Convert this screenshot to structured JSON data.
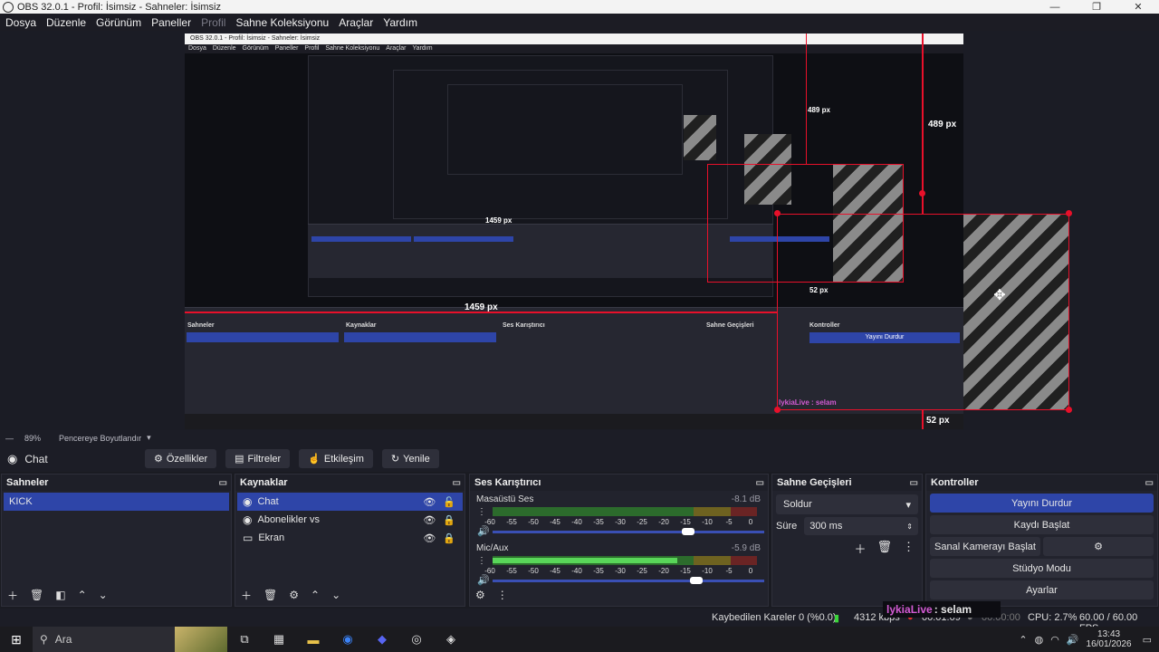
{
  "window": {
    "title": "OBS 32.0.1 - Profil: İsimsiz - Sahneler: İsimsiz",
    "controls": [
      "—",
      "❐",
      "✕"
    ]
  },
  "menu": [
    "Dosya",
    "Düzenle",
    "Görünüm",
    "Paneller",
    "Profil",
    "Sahne Koleksiyonu",
    "Araçlar",
    "Yardım"
  ],
  "preview": {
    "measure_labels": [
      "489 px",
      "1459 px",
      "52 px",
      "489 px",
      "1459 px",
      "52 px"
    ],
    "mini_title": "OBS 32.0.1 - Profil: İsimsiz - Sahneler: İsimsiz",
    "mini_docks": {
      "scenes": "Sahneler",
      "sources": "Kaynaklar",
      "mixer": "Ses Karıştırıcı",
      "transitions": "Sahne Geçişleri",
      "controls": "Kontroller"
    },
    "mini_stop": "Yayını Durdur",
    "mini_chat": "lykiaLive : selam"
  },
  "zoom": {
    "value": "89%",
    "mode": "Pencereye Boyutlandır"
  },
  "source_toolbar": {
    "current_source": "Chat",
    "buttons": [
      "Özellikler",
      "Filtreler",
      "Etkileşim",
      "Yenile"
    ]
  },
  "scenes": {
    "title": "Sahneler",
    "items": [
      "KICK"
    ]
  },
  "sources": {
    "title": "Kaynaklar",
    "items": [
      {
        "label": "Chat",
        "icon": "globe-icon"
      },
      {
        "label": "Abonelikler vs",
        "icon": "globe-icon"
      },
      {
        "label": "Ekran",
        "icon": "monitor-icon"
      }
    ]
  },
  "mixer": {
    "title": "Ses Karıştırıcı",
    "channels": [
      {
        "name": "Masaüstü Ses",
        "db": "-8.1 dB",
        "level": 0.0,
        "volume": 0.72
      },
      {
        "name": "Mic/Aux",
        "db": "-5.9 dB",
        "level": 0.7,
        "volume": 0.75
      }
    ],
    "scale": [
      "-60",
      "-55",
      "-50",
      "-45",
      "-40",
      "-35",
      "-30",
      "-25",
      "-20",
      "-15",
      "-10",
      "-5",
      "0"
    ]
  },
  "transitions": {
    "title": "Sahne Geçişleri",
    "selected": "Soldur",
    "duration_label": "Süre",
    "duration_value": "300 ms"
  },
  "controls": {
    "title": "Kontroller",
    "buttons": [
      "Yayını Durdur",
      "Kaydı Başlat",
      "Sanal Kamerayı Başlat",
      "Stüdyo Modu",
      "Ayarlar"
    ]
  },
  "chat_overlay": {
    "user": "lykiaLive",
    "message": ": selam"
  },
  "status": {
    "dropped": "Kaybedilen Kareler 0 (%0.0)",
    "bitrate": "4312 kbps",
    "live_time": "00:01:09",
    "rec_time": "00:00:00",
    "cpu": "CPU: 2.7%",
    "fps": "60.00 / 60.00 FPS"
  },
  "taskbar": {
    "search_placeholder": "Ara",
    "time": "13:43",
    "date": "16/01/2026"
  }
}
